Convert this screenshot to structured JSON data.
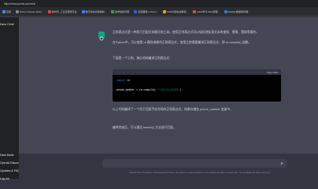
{
  "browser": {
    "url": "https://chat.openai.com/chat"
  },
  "bookmarks": [
    {
      "label": "应用",
      "color": "#4a8af4"
    },
    {
      "label": "Some Chinese Tools...",
      "color": "#888888"
    },
    {
      "label": "新时代_工业互联网平台",
      "color": "#e04a3f"
    },
    {
      "label": "数字化车间智能制...",
      "color": "#3d7eff"
    },
    {
      "label": "数学建模竞赛",
      "color": "#2fa84f"
    },
    {
      "label": "百度翻译 | Chrom...",
      "color": "#2d5fe3"
    },
    {
      "label": "OCR识别在线转换...",
      "color": "#f2a900"
    },
    {
      "label": "JAVA学习-Web流程...",
      "color": "#d94b4b"
    },
    {
      "label": "MySQL数据库管理...",
      "color": "#2b7bd6"
    }
  ],
  "sidebar": {
    "new_chat": "New Chat",
    "bottom_items": [
      "Dark Mode",
      "OpenAI Discord",
      "Updates & FAQ",
      "Log out"
    ]
  },
  "message": {
    "p1": "正则表达式是一种用于匹配文本模式的工具。使用正则表达式可以轻松地实现文本的查找、替换、提取等操作。",
    "p2": "在Python中，可以使用 re 模块来操作正则表达式。使用之前需要编译正则表达式，即 re.compile() 函数。",
    "p3": "下面是一个示例，演示如何编译正则表达式：",
    "code_lang_copy": "Copy code",
    "code_line1_kw": "import",
    "code_line1_rest": " re",
    "code_line2_var": "phone_number = re.compile(",
    "code_line2_str": "r'^1[3-9]\\d{9}$'",
    "code_line2_end": ")",
    "p4": "以上代码编译了一个用于匹配手机号码的正则表达式，结果存储在 phone_number 变量中。",
    "p5": "编译完成后，可以通过 search() 方法进行匹配。"
  },
  "composer": {
    "footer": "ChatGPT Dec 15 Version. Free Research Preview. Our goal is to make AI systems more natural and safe to interact with. Your feedback will help us improve."
  }
}
